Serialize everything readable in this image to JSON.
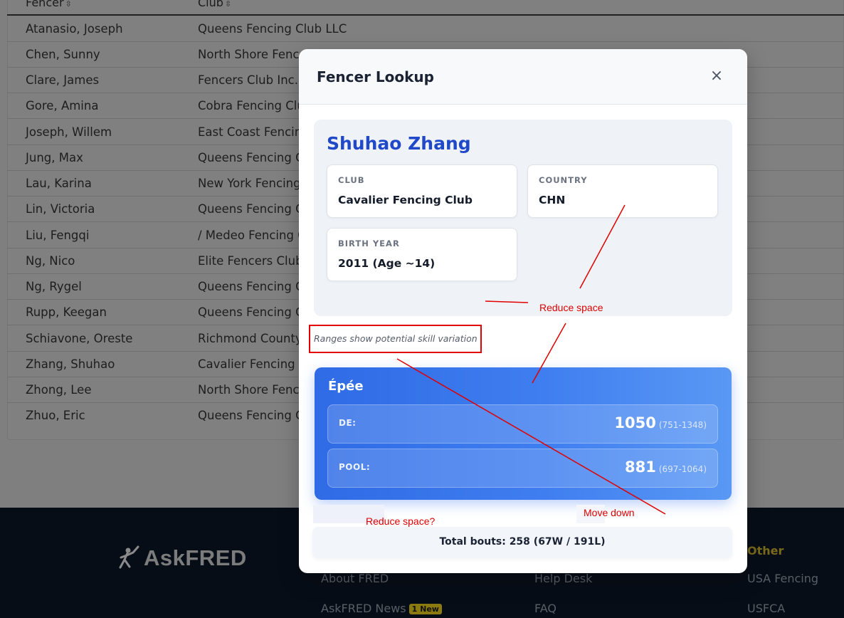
{
  "table": {
    "headers": {
      "fencer": "Fencer",
      "club": "Club"
    },
    "rows": [
      {
        "name": "Atanasio, Joseph",
        "club": "Queens Fencing Club LLC"
      },
      {
        "name": "Chen, Sunny",
        "club": "North Shore Fence"
      },
      {
        "name": "Clare, James",
        "club": "Fencers Club Inc."
      },
      {
        "name": "Gore, Amina",
        "club": "Cobra Fencing Clu"
      },
      {
        "name": "Joseph, Willem",
        "club": "East Coast Fencin"
      },
      {
        "name": "Jung, Max",
        "club": "Queens Fencing C"
      },
      {
        "name": "Lau, Karina",
        "club": "New York Fencing"
      },
      {
        "name": "Lin, Victoria",
        "club": "Queens Fencing C"
      },
      {
        "name": "Liu, Fengqi",
        "club": "/ Medeo Fencing C"
      },
      {
        "name": "Ng, Nico",
        "club": "Elite Fencers Club"
      },
      {
        "name": "Ng, Rygel",
        "club": "Queens Fencing C"
      },
      {
        "name": "Rupp, Keegan",
        "club": "Queens Fencing C"
      },
      {
        "name": "Schiavone, Oreste",
        "club": "Richmond County"
      },
      {
        "name": "Zhang, Shuhao",
        "club": "Cavalier Fencing C"
      },
      {
        "name": "Zhong, Lee",
        "club": "North Shore Fence"
      },
      {
        "name": "Zhuo, Eric",
        "club": "Queens Fencing C"
      }
    ]
  },
  "footer": {
    "logo_text": "AskFRED",
    "links": {
      "about": "About FRED",
      "news": "AskFRED News",
      "news_badge": "1 New",
      "help": "Help Desk",
      "faq": "FAQ",
      "other_heading": "Other",
      "usa_fencing": "USA Fencing",
      "usfca": "USFCA"
    }
  },
  "modal": {
    "title": "Fencer Lookup",
    "close_glyph": "×",
    "fencer_name": "Shuhao Zhang",
    "club_label": "CLUB",
    "club_value": "Cavalier Fencing Club",
    "country_label": "COUNTRY",
    "country_value": "CHN",
    "birth_label": "BIRTH YEAR",
    "birth_value": "2011 (Age ~14)",
    "ranges_note": "Ranges show potential skill variation",
    "weapon": {
      "name": "Épée",
      "ratings": [
        {
          "label": "DE:",
          "value": "1050",
          "range": "(751-1348)"
        },
        {
          "label": "POOL:",
          "value": "881",
          "range": "(697-1064)"
        }
      ]
    },
    "total_bouts": "Total bouts: 258 (67W / 191L)"
  },
  "annotations": {
    "reduce_space": "Reduce space",
    "reduce_space_q": "Reduce space?",
    "move_down": "Move down",
    "color": "#e00000"
  }
}
